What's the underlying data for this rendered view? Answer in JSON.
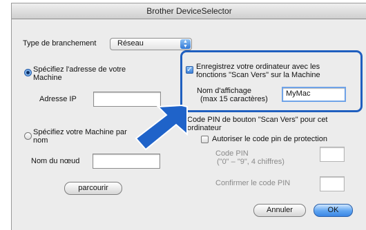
{
  "window": {
    "title": "Brother DeviceSelector"
  },
  "connection": {
    "label": "Type de branchement",
    "value": "Réseau"
  },
  "left": {
    "radio_address": "Spécifiez l'adresse de votre",
    "radio_address_line2": "Machine",
    "ip_label": "Adresse IP",
    "ip_value": "",
    "radio_name": "Spécifiez votre Machine par",
    "radio_name_line2": "nom",
    "node_label": "Nom du nœud",
    "node_value": "",
    "browse_button": "parcourir"
  },
  "scan_to": {
    "checkbox_label_line1": "Enregistrez votre ordinateur avec les",
    "checkbox_label_line2": "fonctions \"Scan Vers\" sur la Machine",
    "display_name_label": "Nom d'affichage",
    "display_name_hint": "(max 15 caractères)",
    "display_name_value": "MyMac"
  },
  "pin": {
    "heading_line1": "Code PIN de bouton \"Scan Vers\" pour cet",
    "heading_line2": "ordinateur",
    "protect_label": "Autoriser le code pin de protection",
    "code_label": "Code PIN",
    "code_hint": "(\"0\" – \"9\", 4 chiffres)",
    "confirm_label": "Confirmer le code PIN",
    "code_value": "",
    "confirm_value": ""
  },
  "footer": {
    "cancel_button": "Annuler",
    "ok_button": "OK"
  }
}
